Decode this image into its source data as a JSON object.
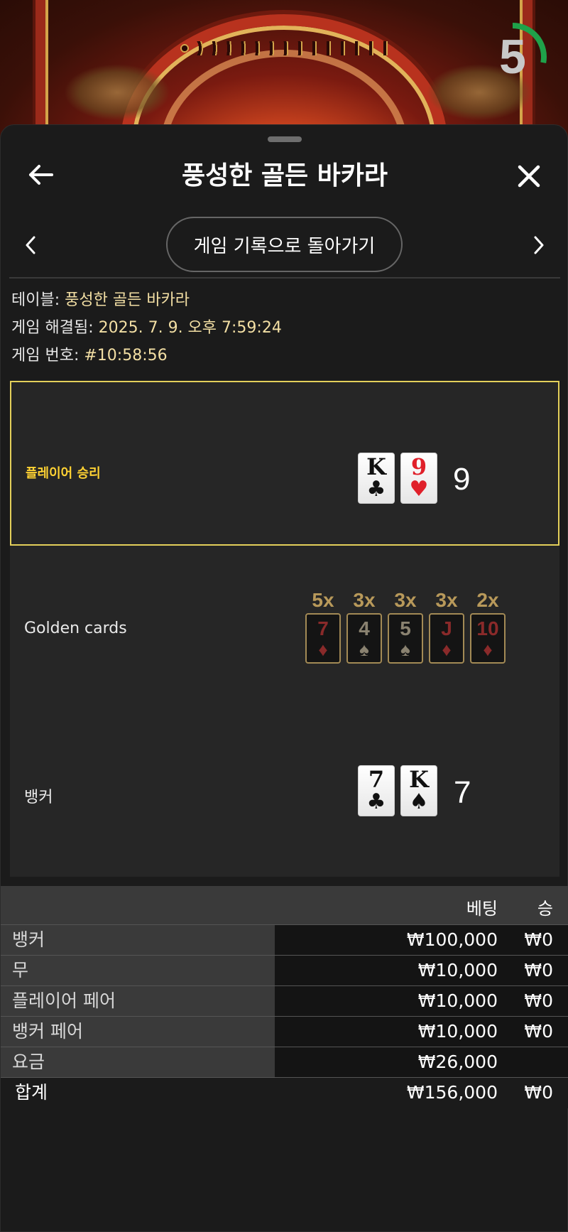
{
  "timer": {
    "value": "5",
    "progress": 0.28,
    "color": "#1fa24a"
  },
  "header": {
    "title": "풍성한 골든 바카라",
    "back_icon": "arrow-left-icon",
    "close_icon": "close-icon"
  },
  "nav": {
    "back_to_history_label": "게임 기록으로 돌아가기",
    "prev_icon": "chevron-left-icon",
    "next_icon": "chevron-right-icon"
  },
  "info": {
    "table_label": "테이블: ",
    "table_value": "풍성한 골든 바카라",
    "resolved_label": "게임 해결됨: ",
    "resolved_value": "2025. 7. 9. 오후 7:59:24",
    "game_no_label": "게임 번호: ",
    "game_no_value": "#10:58:56"
  },
  "player": {
    "label": "플레이어 승리",
    "cards": [
      {
        "rank": "K",
        "suit": "♣",
        "color": "black"
      },
      {
        "rank": "9",
        "suit": "♥",
        "color": "red"
      }
    ],
    "score": "9"
  },
  "golden": {
    "label": "Golden cards",
    "cards": [
      {
        "multiplier": "5x",
        "rank": "7",
        "suit": "♦",
        "color": "red"
      },
      {
        "multiplier": "3x",
        "rank": "4",
        "suit": "♠",
        "color": "black"
      },
      {
        "multiplier": "3x",
        "rank": "5",
        "suit": "♠",
        "color": "black"
      },
      {
        "multiplier": "3x",
        "rank": "J",
        "suit": "♦",
        "color": "red"
      },
      {
        "multiplier": "2x",
        "rank": "10",
        "suit": "♦",
        "color": "red"
      }
    ]
  },
  "banker": {
    "label": "뱅커",
    "cards": [
      {
        "rank": "7",
        "suit": "♣",
        "color": "black"
      },
      {
        "rank": "K",
        "suit": "♠",
        "color": "black"
      }
    ],
    "score": "7"
  },
  "bets": {
    "header": {
      "bet": "베팅",
      "win": "승"
    },
    "rows": [
      {
        "name": "뱅커",
        "bet": "₩100,000",
        "win": "₩0"
      },
      {
        "name": "무",
        "bet": "₩10,000",
        "win": "₩0"
      },
      {
        "name": "플레이어 페어",
        "bet": "₩10,000",
        "win": "₩0"
      },
      {
        "name": "뱅커 페어",
        "bet": "₩10,000",
        "win": "₩0"
      },
      {
        "name": "요금",
        "bet": "₩26,000",
        "win": ""
      }
    ],
    "total": {
      "name": "합계",
      "bet": "₩156,000",
      "win": "₩0"
    }
  }
}
